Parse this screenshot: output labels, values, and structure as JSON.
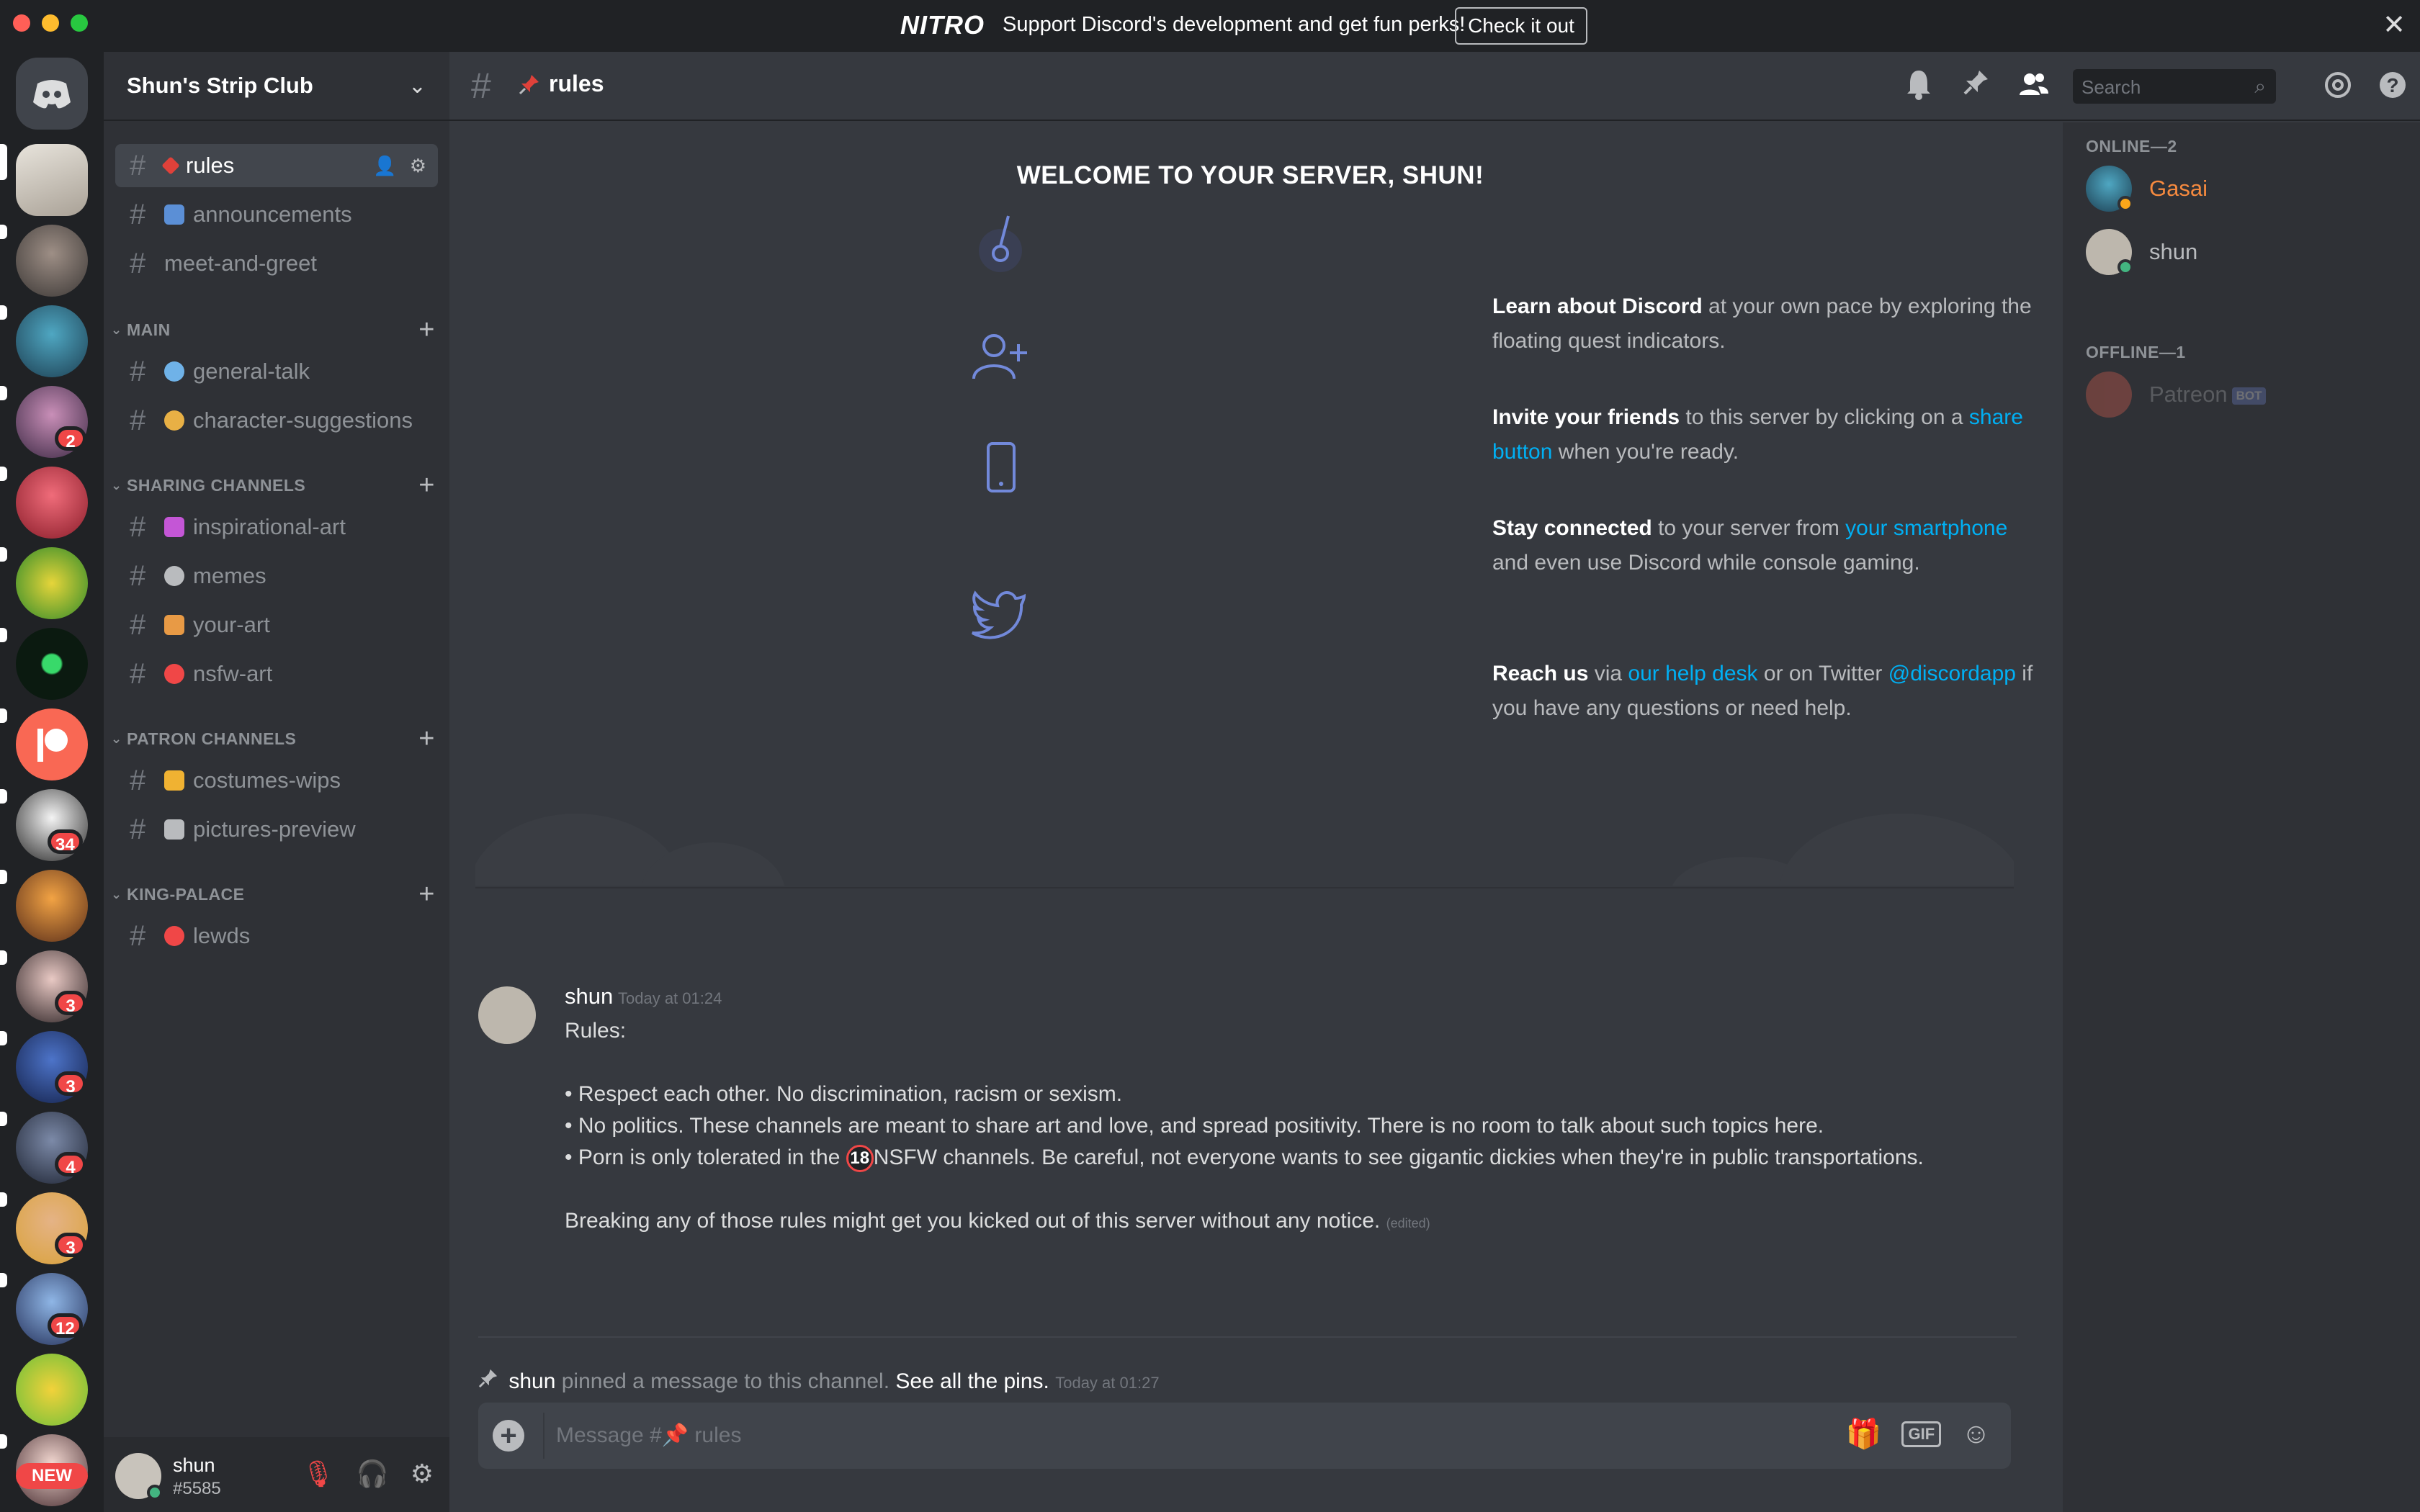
{
  "nitro_banner": {
    "logo": "NITRO",
    "message": "Support Discord's development and get fun perks!",
    "cta": "Check it out",
    "close": "✕"
  },
  "server_rail": {
    "badges": [
      "2",
      "34",
      "3",
      "3",
      "4",
      "3",
      "12"
    ],
    "new_label": "NEW"
  },
  "server": {
    "name": "Shun's Strip Club"
  },
  "channels": {
    "top": [
      {
        "name": "rules",
        "emoji_color": "#e0413a"
      },
      {
        "name": "announcements",
        "emoji_color": "#5b8fd6"
      },
      {
        "name": "meet-and-greet"
      }
    ],
    "categories": [
      {
        "label": "MAIN",
        "channels": [
          {
            "name": "general-talk",
            "emoji_color": "#6fb2e8"
          },
          {
            "name": "character-suggestions",
            "emoji_color": "#e8b045"
          }
        ]
      },
      {
        "label": "SHARING CHANNELS",
        "channels": [
          {
            "name": "inspirational-art",
            "emoji_color": "#c456d6"
          },
          {
            "name": "memes",
            "emoji_color": "#b9bbbe"
          },
          {
            "name": "your-art",
            "emoji_color": "#e89a45"
          },
          {
            "name": "nsfw-art",
            "emoji_color": "#f04747"
          }
        ]
      },
      {
        "label": "PATRON CHANNELS",
        "channels": [
          {
            "name": "costumes-wips",
            "emoji_color": "#f0b232"
          },
          {
            "name": "pictures-preview",
            "emoji_color": "#b9bbbe"
          }
        ]
      },
      {
        "label": "KING-PALACE",
        "channels": [
          {
            "name": "lewds",
            "emoji_color": "#f04747"
          }
        ]
      }
    ]
  },
  "user": {
    "name": "shun",
    "tag": "#5585"
  },
  "channel_header": {
    "name": "rules",
    "search_placeholder": "Search"
  },
  "welcome": {
    "title": "WELCOME TO YOUR SERVER, SHUN!",
    "tips": [
      {
        "bold": "Learn about Discord",
        "rest": " at your own pace by exploring the floating quest indicators."
      },
      {
        "bold": "Invite your friends",
        "pre": " to this server by clicking on a ",
        "link": "share button",
        "post": " when you're ready."
      },
      {
        "bold": "Stay connected",
        "pre": " to your server from ",
        "link": "your smartphone",
        "post": " and even use Discord while console gaming."
      },
      {
        "bold": "Reach us",
        "pre": " via ",
        "link": "our help desk",
        "mid": " or on Twitter ",
        "link2": "@discordapp",
        "post": " if you have any questions or need help."
      }
    ]
  },
  "message": {
    "author": "shun",
    "time": "Today at 01:24",
    "lines": {
      "intro": "Rules:",
      "rule1": "• Respect each other. No discrimination, racism or sexism.",
      "rule2": "• No politics. These channels are meant to share art and love, and spread positivity. There is no room to talk about such topics here.",
      "rule3_pre": "• Porn is only tolerated in the ",
      "rule3_badge": "18",
      "rule3_post": "NSFW channels. Be careful, not everyone wants to see gigantic dickies when they're in public transportations.",
      "outro": "Breaking any of those rules might get you kicked out of this server without any notice.",
      "edited": "(edited)"
    }
  },
  "pin_notice": {
    "who": "shun",
    "text": " pinned a message to this channel. ",
    "link": "See all the pins.",
    "time": "Today at 01:27"
  },
  "composer": {
    "placeholder": "Message #📌 rules",
    "gif_label": "GIF"
  },
  "members": {
    "online_label": "ONLINE—2",
    "offline_label": "OFFLINE—1",
    "online": [
      {
        "name": "Gasai",
        "color": "#f68a3f",
        "status_color": "#faa61a"
      },
      {
        "name": "shun",
        "color": "#b9bbbe",
        "status_color": "#43b581"
      }
    ],
    "offline": [
      {
        "name": "Patreon",
        "bot_tag": "BOT"
      }
    ]
  }
}
